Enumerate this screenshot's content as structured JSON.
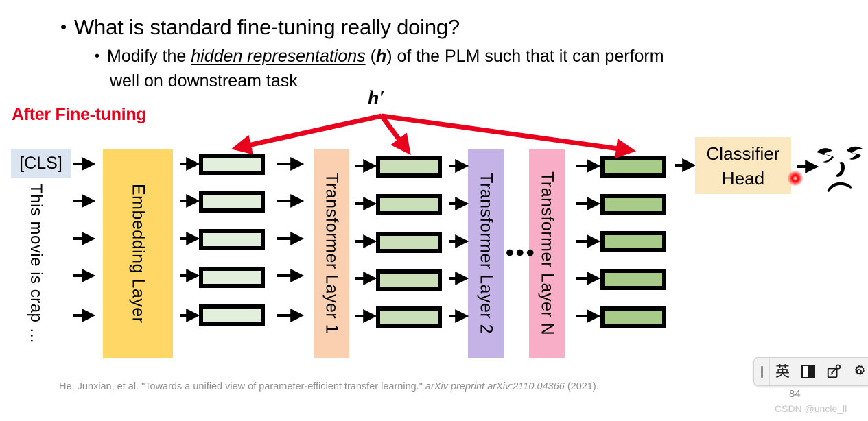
{
  "slide": {
    "bullets": {
      "level1": "What is standard fine-tuning really doing?",
      "level2_part1": "Modify the ",
      "level2_emph": "hidden representations",
      "level2_part2": " (",
      "level2_h": "h",
      "level2_part3": ") of the PLM such that it can perform",
      "level2_line2": "well on downstream task"
    },
    "section_label": "After Fine-tuning",
    "section_label_color": "#e8001c",
    "h_prime_label": "h′",
    "page_number": "84",
    "watermark": "CSDN @uncle_ll"
  },
  "diagram": {
    "input": {
      "cls_token": "[CLS]",
      "cls_bg_color": "#dbe5f1",
      "sentence": "This movie is crap …"
    },
    "layers": [
      {
        "name": "embedding-layer",
        "label": "Embedding Layer",
        "color": "#ffd766"
      },
      {
        "name": "transformer-layer-1",
        "label": "Transformer Layer 1",
        "color": "#fbd0b0"
      },
      {
        "name": "transformer-layer-2",
        "label": "Transformer Layer 2",
        "color": "#c5b3e8"
      },
      {
        "name": "transformer-layer-n",
        "label": "Transformer Layer N",
        "color": "#f8aec6"
      }
    ],
    "ellipsis": "•••",
    "hidden_state_columns": [
      {
        "name": "hidden-states-after-embedding",
        "color": "#e3efdd",
        "count": 5
      },
      {
        "name": "hidden-states-after-layer-1",
        "color": "#cadfb8",
        "count": 5
      },
      {
        "name": "hidden-states-after-layer-n",
        "color": "#a9cb8a",
        "count": 5
      }
    ],
    "classifier": {
      "line1": "Classifier",
      "line2": "Head",
      "color": "#fbe8c0"
    },
    "output_face": "sad-face",
    "arrow_color_red": "#e8001c",
    "arrow_color_black": "#000000"
  },
  "citation": {
    "authors": "He, Junxian, et al.",
    "title": "\"Towards a unified view of parameter-efficient transfer learning.\"",
    "venue": "arXiv preprint",
    "identifier": "arXiv:2110.04366",
    "year": "(2021)."
  },
  "ime_toolbar": {
    "handle": "drag-handle",
    "language_mode": "英",
    "width_mode": "halfwidth-icon",
    "tools_icon": "pen-notepad-icon",
    "settings_icon": "gear-icon"
  }
}
